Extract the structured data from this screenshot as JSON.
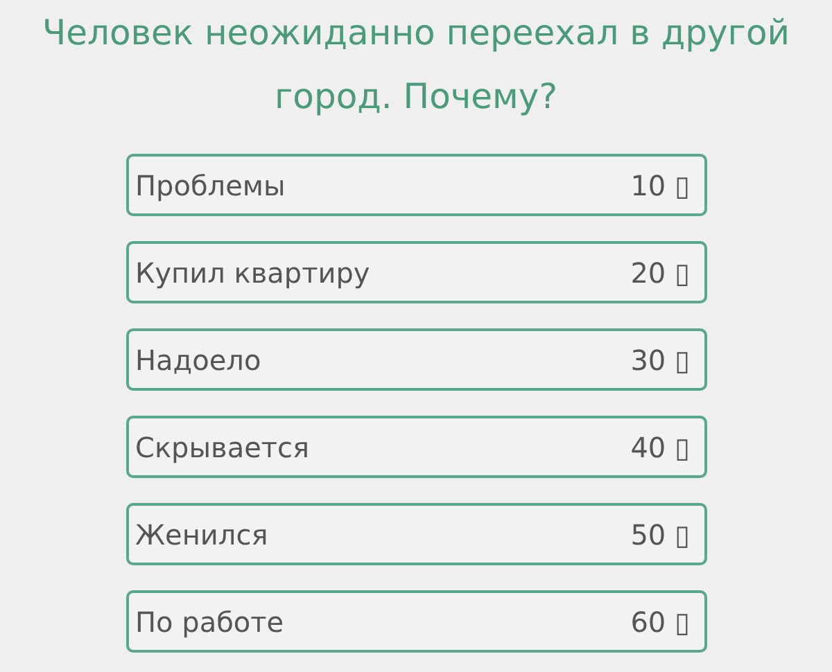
{
  "question": "Человек неожиданно переехал в другой город. Почему?",
  "answers": [
    {
      "label": "Проблемы",
      "points": "10 ▯"
    },
    {
      "label": "Купил квартиру",
      "points": "20 ▯"
    },
    {
      "label": "Надоело",
      "points": "30 ▯"
    },
    {
      "label": "Скрывается",
      "points": "40 ▯"
    },
    {
      "label": "Женился",
      "points": "50 ▯"
    },
    {
      "label": "По работе",
      "points": "60 ▯"
    }
  ]
}
